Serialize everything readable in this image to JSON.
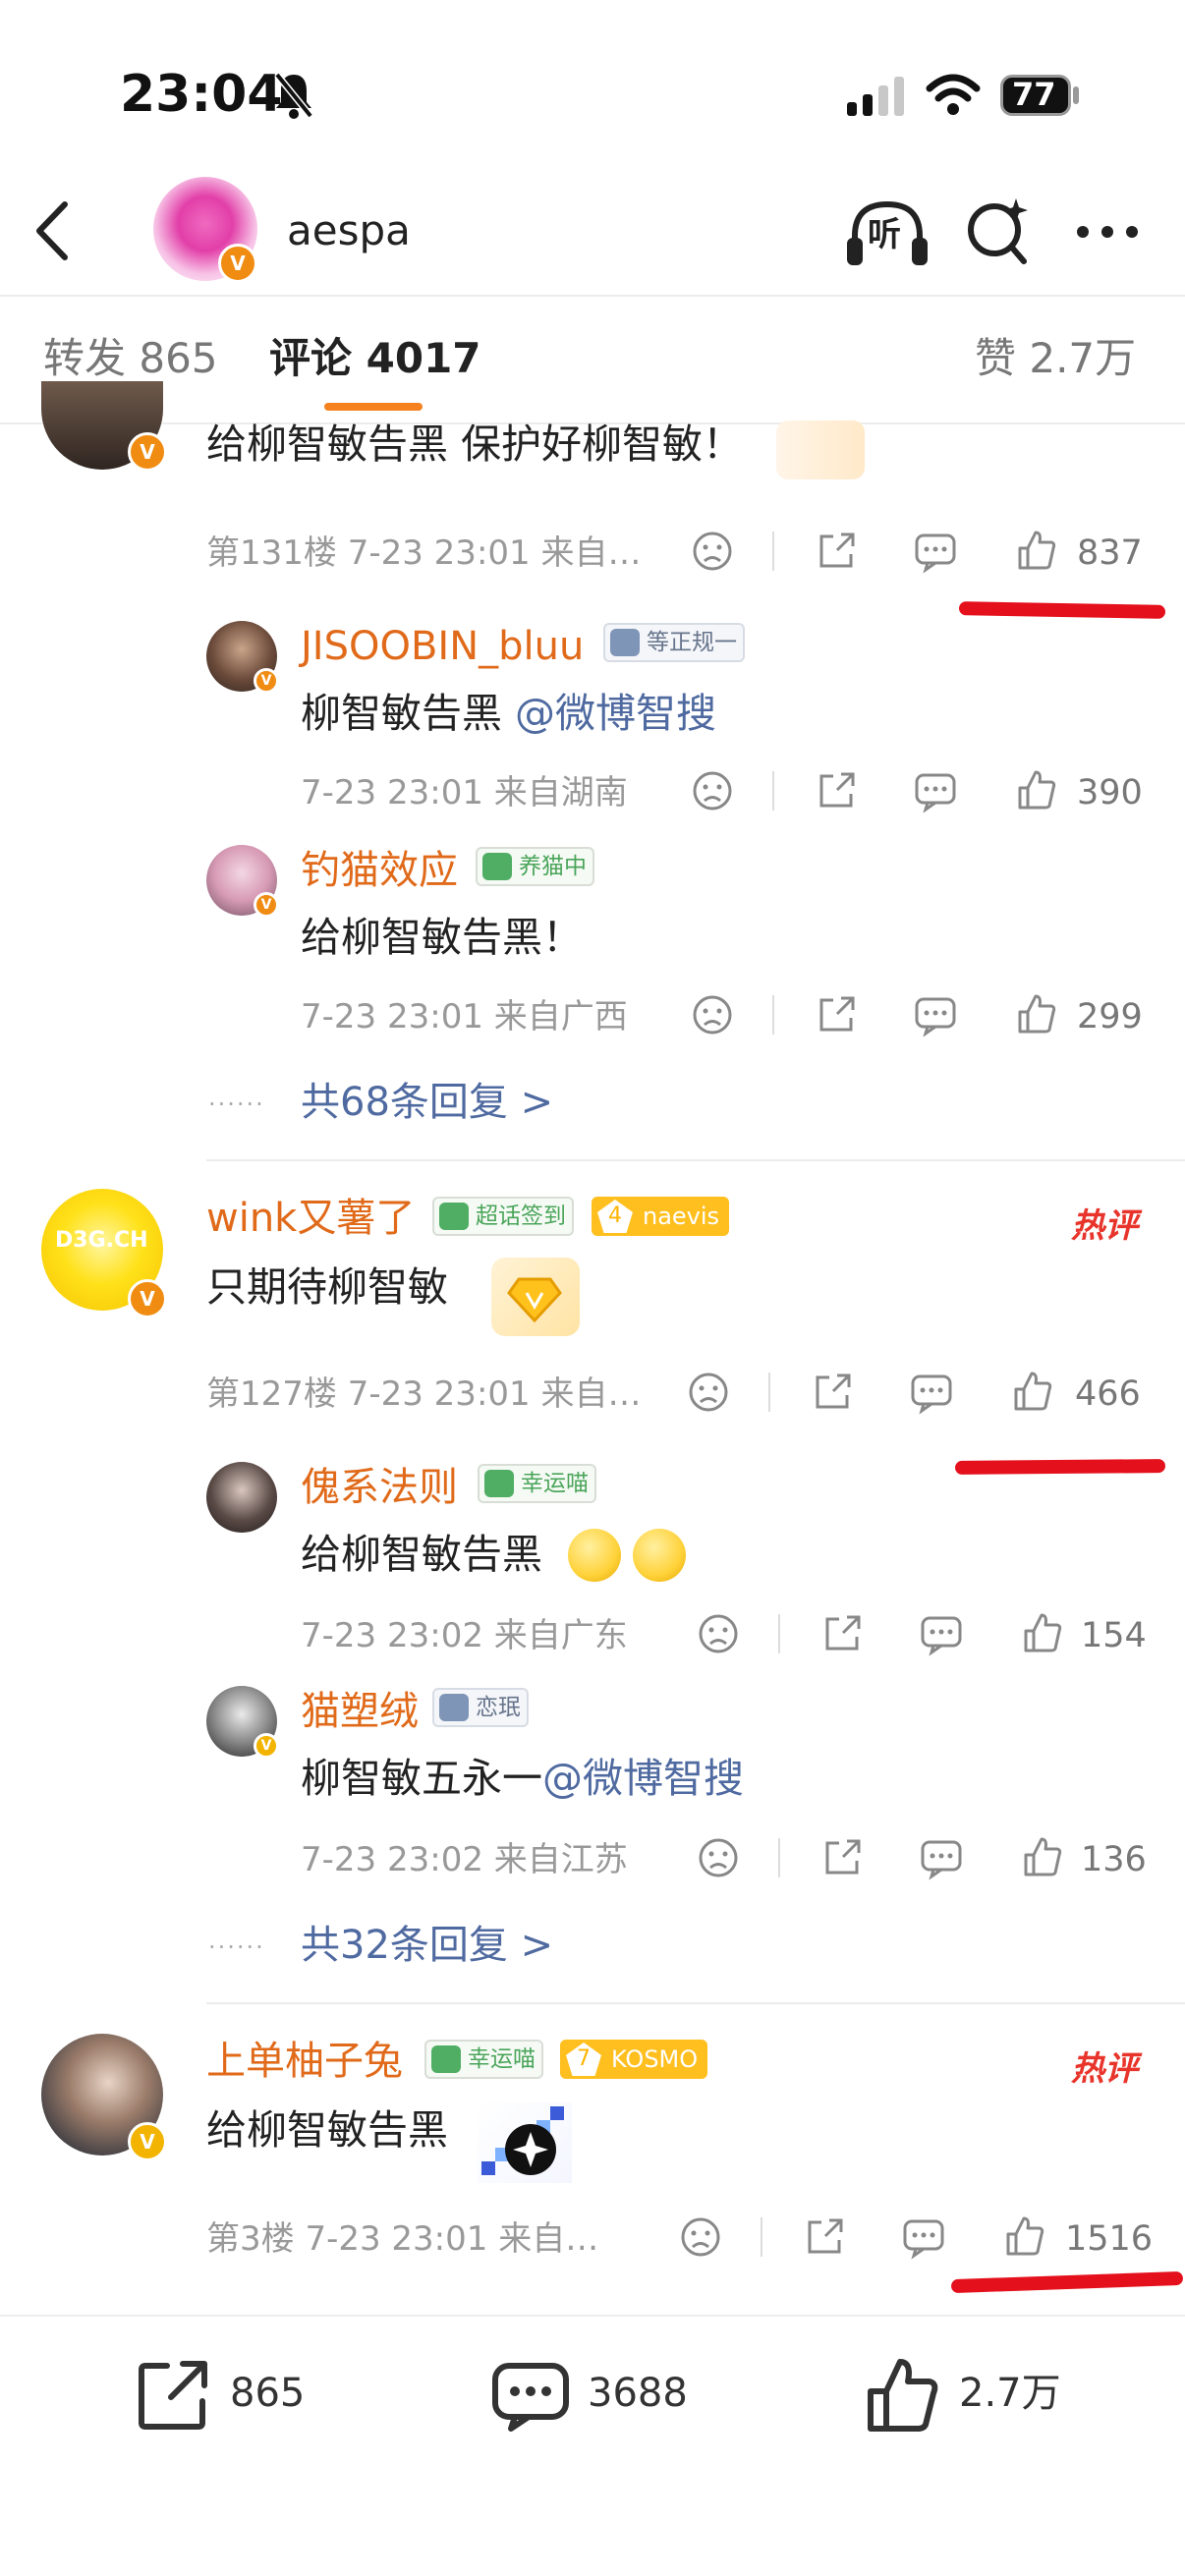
{
  "status_bar": {
    "time": "23:04",
    "battery": "77"
  },
  "header": {
    "account_name": "aespa",
    "listen_label": "听"
  },
  "tabs": {
    "repost": "转发 865",
    "comments": "评论 4017",
    "likes": "赞 2.7万"
  },
  "comments": [
    {
      "text": "给柳智敏告黑 保护好柳智敏！",
      "meta": "第131楼  7-23 23:01  来自…",
      "likes": "837",
      "replies": [
        {
          "username": "JISOOBIN_bluu",
          "badge": "等正规一",
          "text_plain": "柳智敏告黑 ",
          "mention": "@微博智搜",
          "meta": "7-23 23:01  来自湖南",
          "likes": "390"
        },
        {
          "username": "钓猫效应",
          "badge": "养猫中",
          "text_plain": "给柳智敏告黑！",
          "meta": "7-23 23:01  来自广西",
          "likes": "299"
        }
      ],
      "more_replies": "共68条回复 >"
    },
    {
      "username": "wink又薯了",
      "badges": [
        "超话签到",
        "naevis"
      ],
      "badge_level": "4",
      "hot_label": "热评",
      "text": "只期待柳智敏",
      "meta": "第127楼  7-23 23:01  来自…",
      "likes": "466",
      "replies": [
        {
          "username": "傀系法则",
          "badge": "幸运喵",
          "text_plain": "给柳智敏告黑",
          "emoji": "🙂🙂",
          "meta": "7-23 23:02  来自广东",
          "likes": "154"
        },
        {
          "username": "猫塑绒",
          "badge": "恋珉",
          "text_plain": "柳智敏五永一",
          "mention": "@微博智搜",
          "meta": "7-23 23:02  来自江苏",
          "likes": "136"
        }
      ],
      "more_replies": "共32条回复 >"
    },
    {
      "username": "上单柚子兔",
      "badges": [
        "幸运喵",
        "KOSMO"
      ],
      "badge_level": "7",
      "hot_label": "热评",
      "text": "给柳智敏告黑",
      "meta": "第3楼  7-23 23:01  来自…",
      "likes": "1516"
    }
  ],
  "bottom_bar": {
    "repost": "865",
    "comment": "3688",
    "like": "2.7万"
  },
  "colors": {
    "accent": "#f5811f",
    "username": "#e06a1a",
    "link": "#4f6aa0",
    "hot": "#e8342a",
    "annotation": "#e4101c"
  },
  "icons": [
    "back-icon",
    "headphones-icon",
    "sparkle-search-icon",
    "more-icon",
    "sad-face-icon",
    "share-icon",
    "comment-icon",
    "thumbs-up-icon"
  ]
}
